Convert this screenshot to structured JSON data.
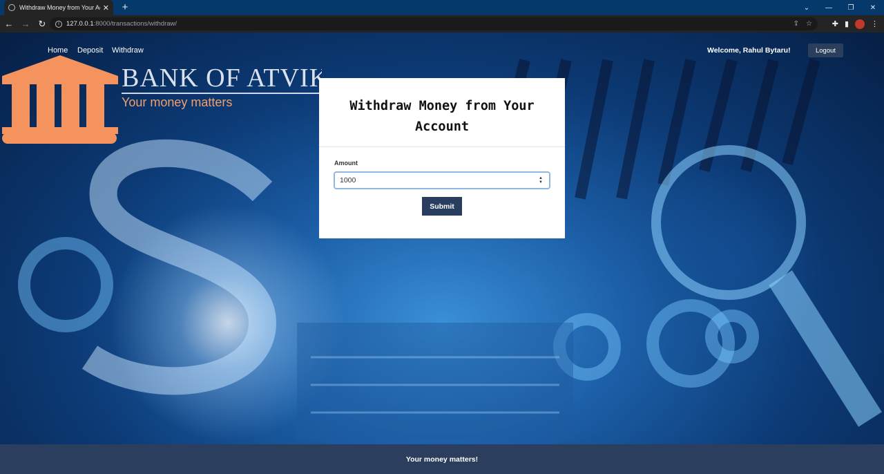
{
  "browser": {
    "tab_title": "Withdraw Money from Your Acco",
    "url_host": "127.0.0.1",
    "url_path": ":8000/transactions/withdraw/"
  },
  "nav": {
    "home": "Home",
    "deposit": "Deposit",
    "withdraw": "Withdraw",
    "welcome": "Welcome, Rahul Bytaru!",
    "logout": "Logout"
  },
  "brand": {
    "name": "BANK OF ATVIK",
    "tagline": "Your money matters"
  },
  "form": {
    "title": "Withdraw Money from Your Account",
    "amount_label": "Amount",
    "amount_value": "1000",
    "submit_label": "Submit"
  },
  "footer": {
    "text": "Your money matters!"
  },
  "colors": {
    "brand_orange": "#f4935e",
    "button_navy": "#293d5e",
    "footer_bg": "#2c3e5e"
  }
}
